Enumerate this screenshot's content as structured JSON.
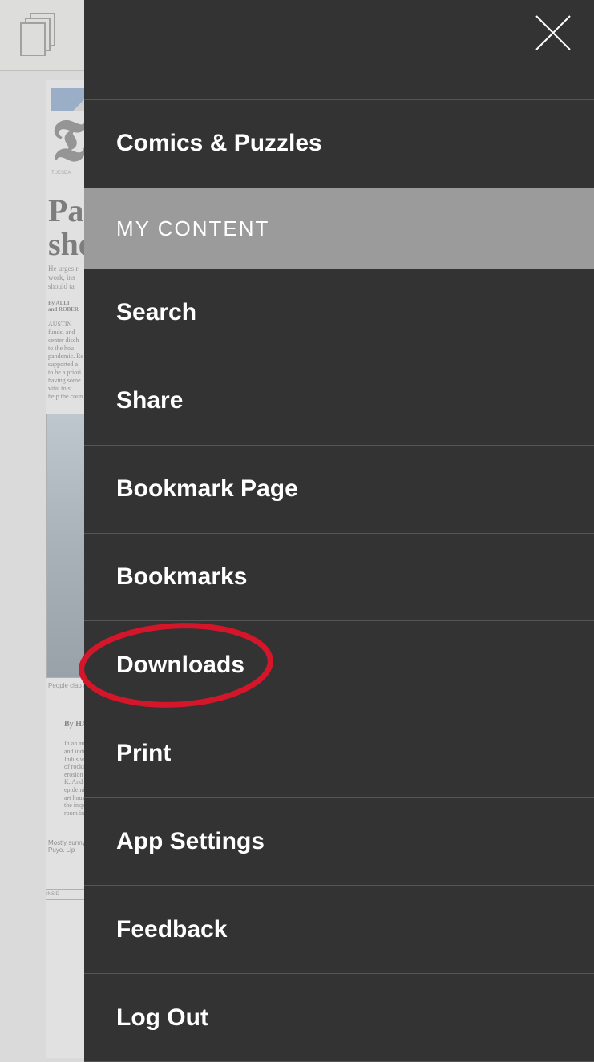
{
  "drawer": {
    "items": [
      {
        "label": "Comics & Puzzles"
      }
    ],
    "section_header": "MY CONTENT",
    "content_items": [
      {
        "label": "Search",
        "highlighted": false
      },
      {
        "label": "Share",
        "highlighted": false
      },
      {
        "label": "Bookmark Page",
        "highlighted": false
      },
      {
        "label": "Bookmarks",
        "highlighted": false
      },
      {
        "label": "Downloads",
        "highlighted": true
      },
      {
        "label": "Print",
        "highlighted": false
      },
      {
        "label": "App Settings",
        "highlighted": false
      },
      {
        "label": "Feedback",
        "highlighted": false
      },
      {
        "label": "Log Out",
        "highlighted": false
      }
    ]
  },
  "background": {
    "headline_line1": "Pat",
    "headline_line2": "shel",
    "subhead": "He urges r\nwork, ins\nshould ta",
    "byline": "By ALLI\nand ROBER",
    "body": "AUSTIN\nfunds, and\ncenter disch\nto the hou\npandemic. Re\nsupported a\nto be a priori\nhaving some\nvital to st\nhelp the coun",
    "caption": "People clap a",
    "byline2": "By HA",
    "body2": "In an an\nand indust\nIndus was\nof rocks that\nerosion brou\nK. And How\nepidemic epi\nart housing,\nthe inspirati\nroom in imp",
    "weather": "Mostly sunny\nPuyo. Lip",
    "index_header": "INSID",
    "masthead_meta": "TUESDA"
  }
}
